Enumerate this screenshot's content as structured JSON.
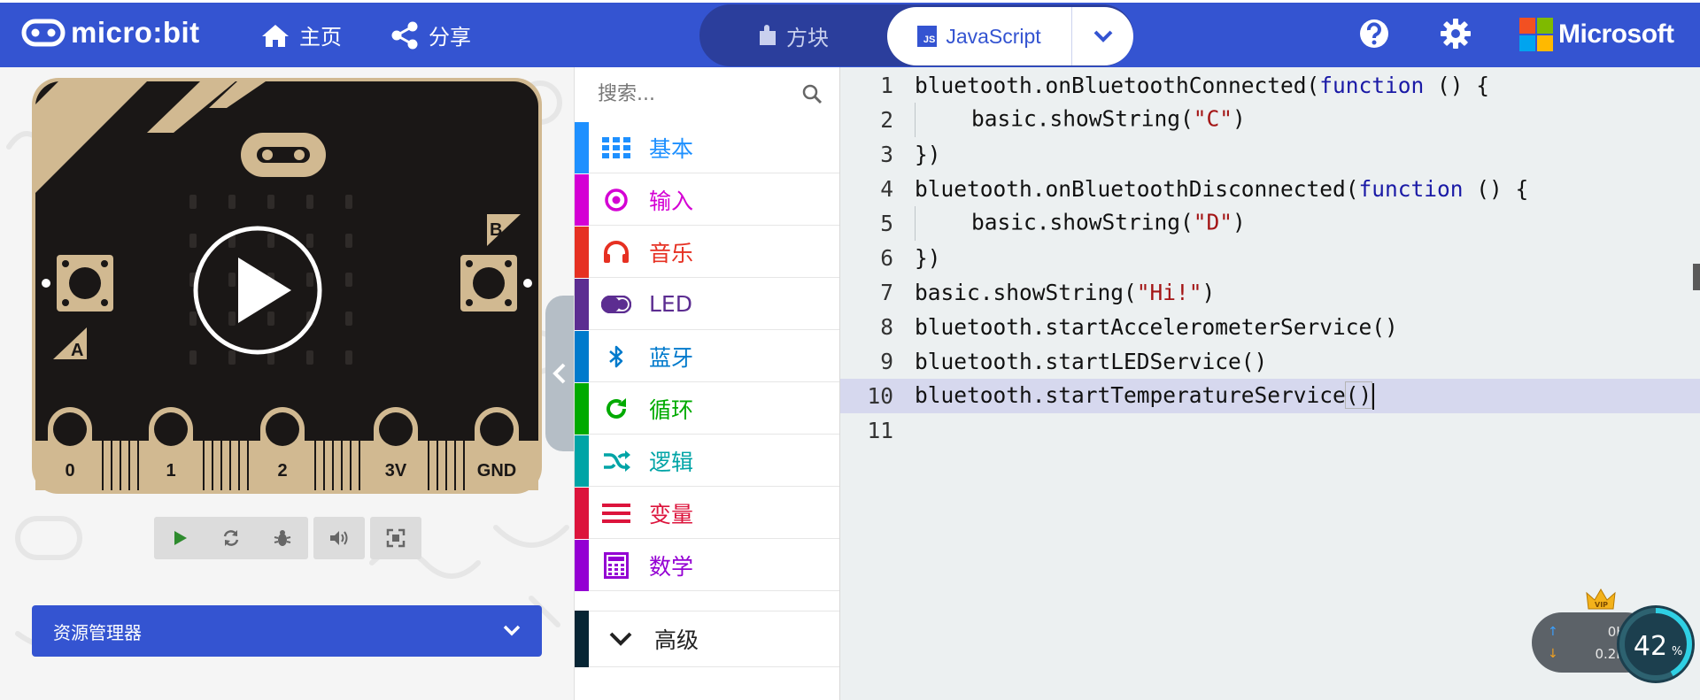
{
  "header": {
    "logo_text": "micro:bit",
    "nav": {
      "home": "主页",
      "share": "分享"
    },
    "mode": {
      "blocks": "方块",
      "javascript": "JavaScript",
      "js_badge": "JS"
    },
    "brand": "Microsoft",
    "colors": {
      "bar": "#3454d1",
      "toggle": "#2b3e9c"
    }
  },
  "simulator": {
    "pins": [
      "0",
      "1",
      "2",
      "3V",
      "GND"
    ],
    "buttons": {
      "a": "A",
      "b": "B"
    },
    "toolbar": [
      "play-icon",
      "restart-icon",
      "debug-icon",
      "sound-icon",
      "fullscreen-icon"
    ]
  },
  "explorer": {
    "label": "资源管理器"
  },
  "toolbox": {
    "search_placeholder": "搜索...",
    "categories": [
      {
        "label": "基本",
        "color": "#1e90ff",
        "icon": "grid-icon"
      },
      {
        "label": "输入",
        "color": "#d400d4",
        "icon": "target-icon"
      },
      {
        "label": "音乐",
        "color": "#e63022",
        "icon": "headphones-icon"
      },
      {
        "label": "LED",
        "color": "#5c2d91",
        "icon": "toggle-icon"
      },
      {
        "label": "蓝牙",
        "color": "#007acc",
        "icon": "bluetooth-icon"
      },
      {
        "label": "循环",
        "color": "#00aa00",
        "icon": "refresh-icon"
      },
      {
        "label": "逻辑",
        "color": "#00a4a6",
        "icon": "shuffle-icon"
      },
      {
        "label": "变量",
        "color": "#dc143c",
        "icon": "list-icon"
      },
      {
        "label": "数学",
        "color": "#9400d3",
        "icon": "calculator-icon"
      }
    ],
    "advanced": "高级"
  },
  "editor": {
    "lines": [
      {
        "n": "1",
        "pre": "bluetooth.onBluetoothConnected(",
        "kw": "function",
        "post": " () {"
      },
      {
        "n": "2",
        "indent": true,
        "pre": "basic.showString(",
        "str": "\"C\"",
        "post": ")"
      },
      {
        "n": "3",
        "pre": "})"
      },
      {
        "n": "4",
        "pre": "bluetooth.onBluetoothDisconnected(",
        "kw": "function",
        "post": " () {"
      },
      {
        "n": "5",
        "indent": true,
        "pre": "basic.showString(",
        "str": "\"D\"",
        "post": ")"
      },
      {
        "n": "6",
        "pre": "})"
      },
      {
        "n": "7",
        "pre": "basic.showString(",
        "str": "\"Hi!\"",
        "post": ")"
      },
      {
        "n": "8",
        "pre": "bluetooth.startAccelerometerService()"
      },
      {
        "n": "9",
        "pre": "bluetooth.startLEDService()"
      },
      {
        "n": "10",
        "pre": "bluetooth.startTemperatureService",
        "paren": "()",
        "current": true
      },
      {
        "n": "11",
        "pre": ""
      }
    ]
  },
  "net_widget": {
    "upload": "0K/s",
    "download": "0.2K/s",
    "percent": "42",
    "percent_sign": "%",
    "level": 0.42
  }
}
